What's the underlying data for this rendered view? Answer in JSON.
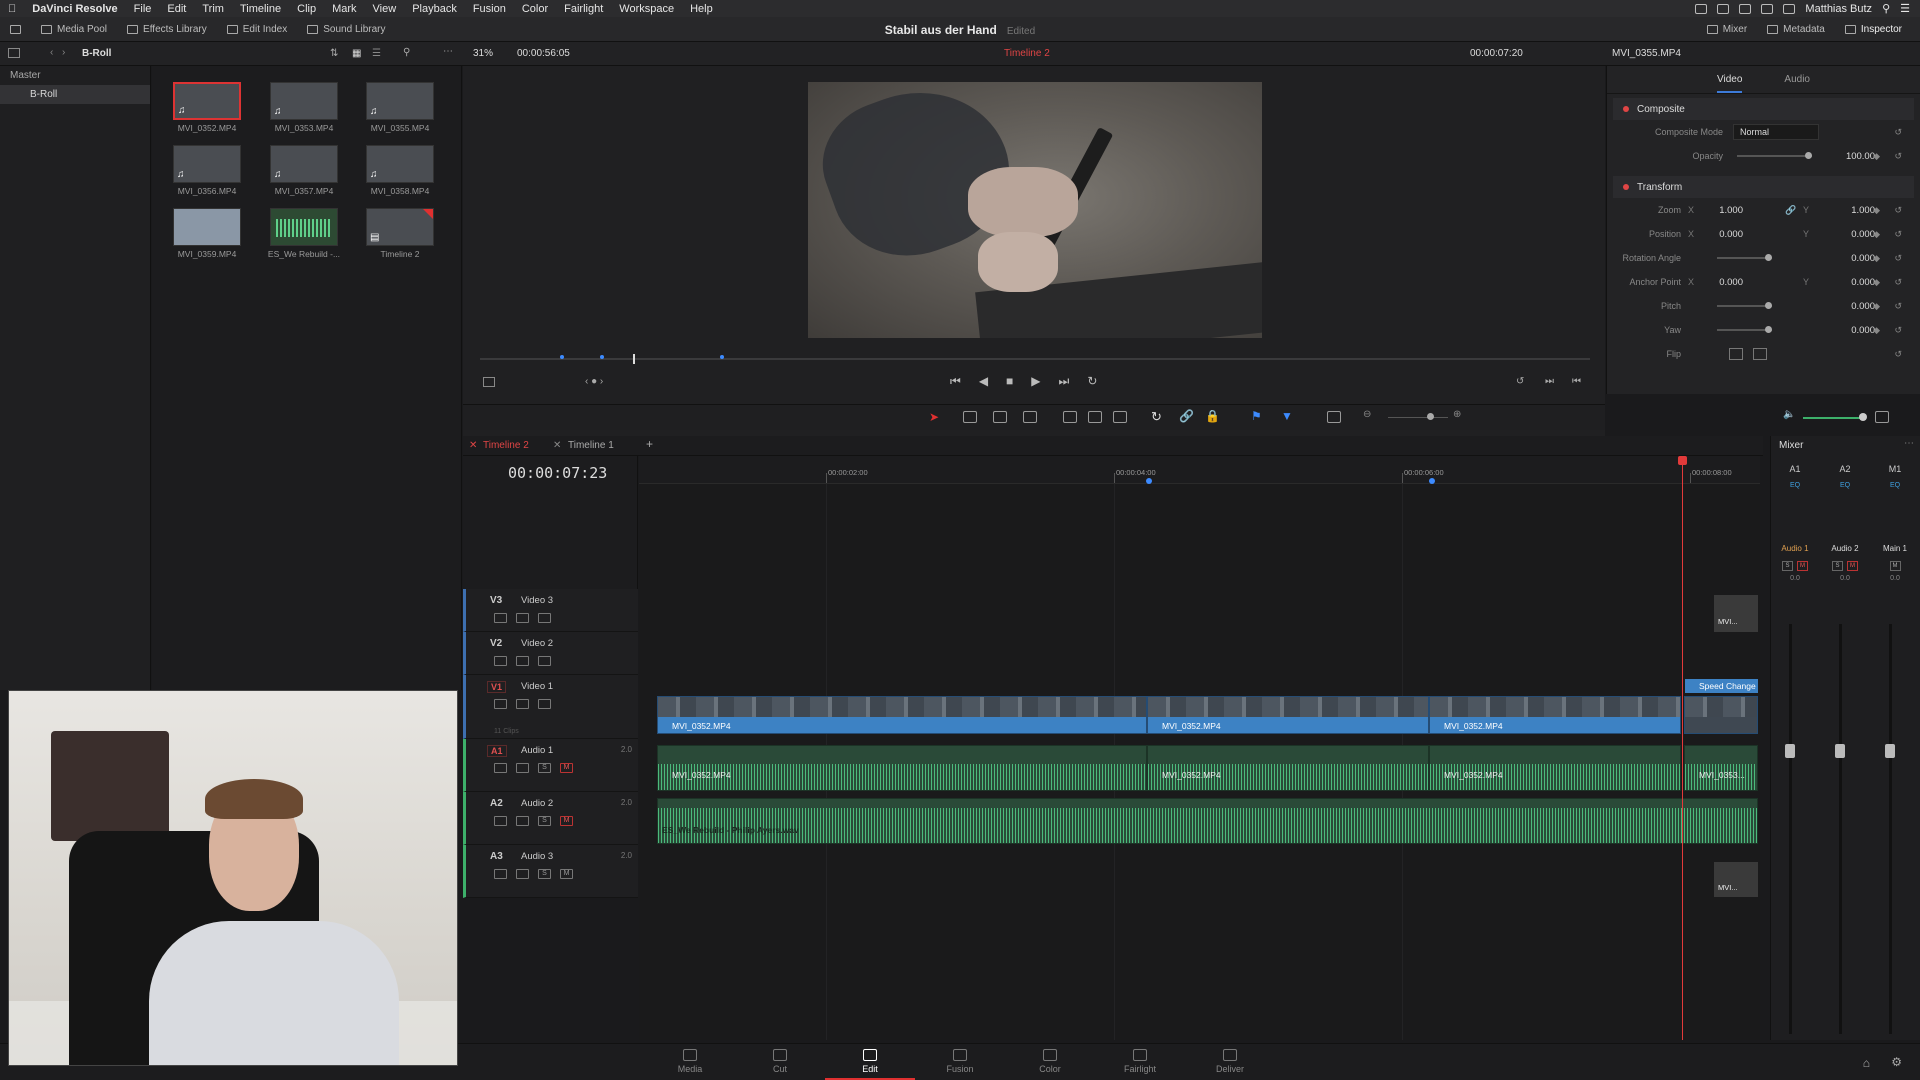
{
  "menubar": {
    "app": "DaVinci Resolve",
    "items": [
      "File",
      "Edit",
      "Trim",
      "Timeline",
      "Clip",
      "Mark",
      "View",
      "Playback",
      "Fusion",
      "Color",
      "Fairlight",
      "Workspace",
      "Help"
    ],
    "user": "Matthias Butz"
  },
  "toolbar": {
    "media_pool": "Media Pool",
    "effects_library": "Effects Library",
    "edit_index": "Edit Index",
    "sound_library": "Sound Library",
    "project_title": "Stabil aus der Hand",
    "project_status": "Edited",
    "mixer": "Mixer",
    "metadata": "Metadata",
    "inspector": "Inspector"
  },
  "bar2": {
    "bin": "B-Roll",
    "zoom": "31%",
    "source_tc": "00:00:56:05",
    "timeline_name": "Timeline 2",
    "record_tc": "00:00:07:20",
    "clip_name": "MVI_0355.MP4"
  },
  "bins": {
    "master": "Master",
    "selected": "B-Roll"
  },
  "clips": [
    {
      "name": "MVI_0352.MP4",
      "selected": true,
      "kind": "video"
    },
    {
      "name": "MVI_0353.MP4",
      "selected": false,
      "kind": "video"
    },
    {
      "name": "MVI_0355.MP4",
      "selected": false,
      "kind": "video"
    },
    {
      "name": "MVI_0356.MP4",
      "selected": false,
      "kind": "video"
    },
    {
      "name": "MVI_0357.MP4",
      "selected": false,
      "kind": "video"
    },
    {
      "name": "MVI_0358.MP4",
      "selected": false,
      "kind": "video"
    },
    {
      "name": "MVI_0359.MP4",
      "selected": false,
      "kind": "video"
    },
    {
      "name": "ES_We Rebuild -...",
      "selected": false,
      "kind": "audio"
    },
    {
      "name": "Timeline 2",
      "selected": false,
      "kind": "timeline"
    }
  ],
  "inspector": {
    "tabs": [
      "Video",
      "Audio"
    ],
    "composite": {
      "title": "Composite",
      "mode_label": "Composite Mode",
      "mode_value": "Normal",
      "opacity_label": "Opacity",
      "opacity_value": "100.00"
    },
    "transform": {
      "title": "Transform",
      "zoom_label": "Zoom",
      "zoom_x": "1.000",
      "zoom_y": "1.000",
      "position_label": "Position",
      "position_x": "0.000",
      "position_y": "0.000",
      "rotation_label": "Rotation Angle",
      "rotation_value": "0.000",
      "anchor_label": "Anchor Point",
      "anchor_x": "0.000",
      "anchor_y": "0.000",
      "pitch_label": "Pitch",
      "pitch_value": "0.000",
      "yaw_label": "Yaw",
      "yaw_value": "0.000",
      "flip_label": "Flip"
    },
    "x": "X",
    "y": "Y"
  },
  "timeline": {
    "tabs": [
      "Timeline 2",
      "Timeline 1"
    ],
    "timecode": "00:00:07:23",
    "ruler_labels": [
      "00:00:02:00",
      "00:00:04:00",
      "00:00:06:00",
      "00:00:08:00"
    ],
    "tracks": {
      "v3": {
        "tag": "V3",
        "name": "Video 3"
      },
      "v2": {
        "tag": "V2",
        "name": "Video 2"
      },
      "v1": {
        "tag": "V1",
        "name": "Video 1",
        "sub": "11 Clips"
      },
      "a1": {
        "tag": "A1",
        "name": "Audio 1",
        "ch": "2.0"
      },
      "a2": {
        "tag": "A2",
        "name": "Audio 2",
        "ch": "2.0"
      },
      "a3": {
        "tag": "A3",
        "name": "Audio 3",
        "ch": "2.0"
      }
    },
    "video_clips": [
      "MVI_0352.MP4",
      "MVI_0352.MP4",
      "MVI_0352.MP4"
    ],
    "audio_clips": [
      "MVI_0352.MP4",
      "MVI_0352.MP4",
      "MVI_0352.MP4",
      "MVI_0353..."
    ],
    "music_clip": "ES_We Rebuild - Philip Ayers.wav",
    "speed_change": "Speed Change",
    "mvi_small": "MVI..."
  },
  "mixer": {
    "title": "Mixer",
    "channels": [
      {
        "id": "A1",
        "name": "Audio 1",
        "db": "0.0"
      },
      {
        "id": "A2",
        "name": "Audio 2",
        "db": "0.0"
      },
      {
        "id": "M1",
        "name": "Main 1",
        "db": "0.0"
      }
    ],
    "eq": "EQ"
  },
  "pages": [
    "Media",
    "Cut",
    "Edit",
    "Fusion",
    "Color",
    "Fairlight",
    "Deliver"
  ],
  "active_page": "Edit",
  "colors": {
    "accent_red": "#e03030",
    "clip_blue": "#3d82c4",
    "audio_green": "#4fc684"
  }
}
